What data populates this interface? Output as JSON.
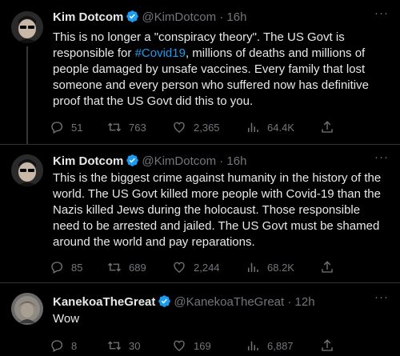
{
  "tweets": [
    {
      "author_name": "Kim Dotcom",
      "handle_time": "@KimDotcom · 16h",
      "text_before": "This is no longer a \"conspiracy theory\". The US Govt is responsible for ",
      "hashtag": "#Covid19",
      "text_after": ", millions of deaths and millions of people damaged by unsafe vaccines. Every family that lost someone and every person who suffered now has definitive proof that the US Govt did this to you.",
      "replies": "51",
      "retweets": "763",
      "likes": "2,365",
      "views": "64.4K"
    },
    {
      "author_name": "Kim Dotcom",
      "handle_time": "@KimDotcom · 16h",
      "text": "This is the biggest crime against humanity in the history of the world. The US Govt killed more people with Covid-19 than the Nazis killed Jews during the holocaust. Those responsible need to be arrested and jailed. The US Govt must be shamed around the world and pay reparations.",
      "replies": "85",
      "retweets": "689",
      "likes": "2,244",
      "views": "68.2K"
    },
    {
      "author_name": "KanekoaTheGreat",
      "handle_time": "@KanekoaTheGreat · 12h",
      "text": "Wow",
      "replies": "8",
      "retweets": "30",
      "likes": "169",
      "views": "6,887"
    }
  ],
  "colors": {
    "background": "#000000",
    "text": "#e7e9ea",
    "muted": "#71767b",
    "accent": "#1d9bf0",
    "divider": "#2f3336"
  }
}
